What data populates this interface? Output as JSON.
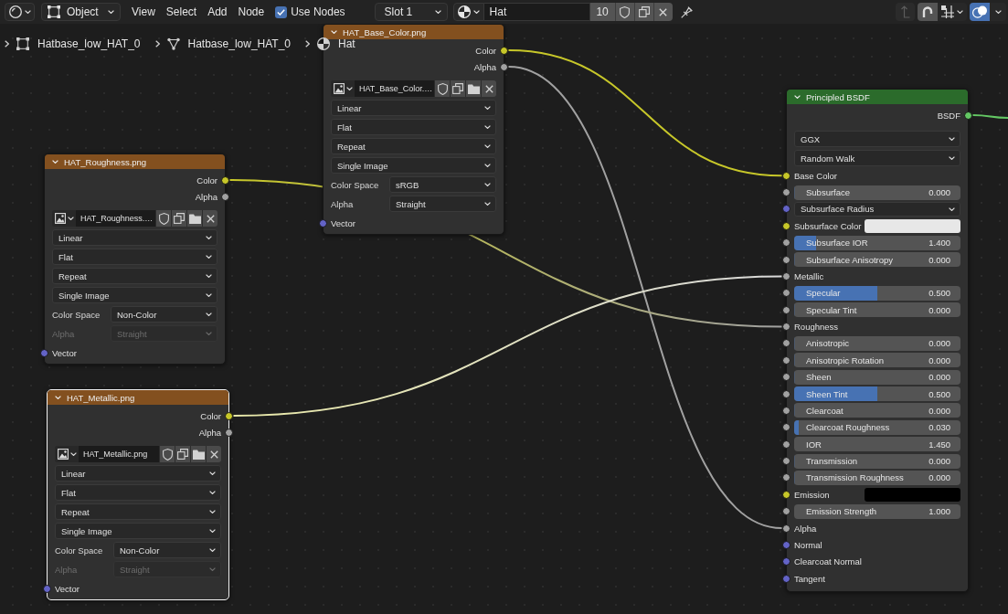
{
  "header": {
    "mode": "Object",
    "menus": [
      "View",
      "Select",
      "Add",
      "Node"
    ],
    "use_nodes": {
      "label": "Use Nodes",
      "checked": true
    },
    "slot": "Slot 1",
    "material": {
      "name": "Hat",
      "users": "10"
    },
    "parent_button": {
      "disabled": true
    },
    "snap": {
      "on": false
    },
    "overlays": {
      "on": true
    }
  },
  "breadcrumbs": [
    {
      "kind": "object",
      "label": "Hatbase_low_HAT_0"
    },
    {
      "kind": "mesh",
      "label": "Hatbase_low_HAT_0"
    },
    {
      "kind": "material",
      "label": "Hat"
    }
  ],
  "nodes": [
    {
      "kind": "image_texture",
      "title": "HAT_Base_Color.png",
      "selected": false,
      "outputs": [
        {
          "label": "Color",
          "socket": {
            "kind": "color"
          },
          "linked": true
        },
        {
          "label": "Alpha",
          "socket": {
            "kind": "float"
          },
          "linked": true
        }
      ],
      "image": "HAT_Base_Color.…",
      "interpolation": "Linear",
      "projection": "Flat",
      "extension": "Repeat",
      "source": "Single Image",
      "color_space": {
        "label": "Color Space",
        "value": "sRGB"
      },
      "alpha": {
        "label": "Alpha",
        "value": "Straight",
        "disabled": false
      },
      "inputs": [
        {
          "label": "Vector",
          "socket": {
            "kind": "vector"
          },
          "kind": "label"
        }
      ]
    },
    {
      "kind": "image_texture",
      "title": "HAT_Roughness.png",
      "selected": false,
      "outputs": [
        {
          "label": "Color",
          "socket": {
            "kind": "color"
          },
          "linked": true
        },
        {
          "label": "Alpha",
          "socket": {
            "kind": "float"
          },
          "linked": false
        }
      ],
      "image": "HAT_Roughness.…",
      "interpolation": "Linear",
      "projection": "Flat",
      "extension": "Repeat",
      "source": "Single Image",
      "color_space": {
        "label": "Color Space",
        "value": "Non-Color"
      },
      "alpha": {
        "label": "Alpha",
        "value": "Straight",
        "disabled": true
      },
      "inputs": [
        {
          "label": "Vector",
          "socket": {
            "kind": "vector"
          },
          "kind": "label"
        }
      ]
    },
    {
      "kind": "image_texture",
      "title": "HAT_Metallic.png",
      "selected": true,
      "outputs": [
        {
          "label": "Color",
          "socket": {
            "kind": "color"
          },
          "linked": true
        },
        {
          "label": "Alpha",
          "socket": {
            "kind": "float"
          },
          "linked": false
        }
      ],
      "image": "HAT_Metallic.png",
      "interpolation": "Linear",
      "projection": "Flat",
      "extension": "Repeat",
      "source": "Single Image",
      "color_space": {
        "label": "Color Space",
        "value": "Non-Color"
      },
      "alpha": {
        "label": "Alpha",
        "value": "Straight",
        "disabled": true
      },
      "inputs": [
        {
          "label": "Vector",
          "socket": {
            "kind": "vector"
          },
          "kind": "label"
        }
      ]
    },
    {
      "kind": "principled_bsdf",
      "title": "Principled BSDF",
      "selected": false,
      "outputs": [
        {
          "label": "BSDF",
          "socket": {
            "kind": "shader"
          },
          "linked": true
        }
      ],
      "distribution": "GGX",
      "subsurface_method": "Random Walk",
      "inputs": [
        {
          "label": "Base Color",
          "socket": {
            "kind": "color"
          },
          "kind": "label"
        },
        {
          "label": "Subsurface",
          "socket": {
            "kind": "float"
          },
          "kind": "slider",
          "value": "0.000",
          "level": 0
        },
        {
          "label": "Subsurface Radius",
          "socket": {
            "kind": "vector"
          },
          "kind": "dropdown"
        },
        {
          "label": "Subsurface Color",
          "socket": {
            "kind": "color"
          },
          "kind": "color",
          "color": "#e7e7e7"
        },
        {
          "label": "Subsurface IOR",
          "socket": {
            "kind": "float"
          },
          "kind": "slider",
          "value": "1.400",
          "level": 0.13
        },
        {
          "label": "Subsurface Anisotropy",
          "socket": {
            "kind": "float"
          },
          "kind": "slider",
          "value": "0.000",
          "level": 0
        },
        {
          "label": "Metallic",
          "socket": {
            "kind": "float"
          },
          "kind": "label"
        },
        {
          "label": "Specular",
          "socket": {
            "kind": "float"
          },
          "kind": "slider",
          "value": "0.500",
          "level": 0.5
        },
        {
          "label": "Specular Tint",
          "socket": {
            "kind": "float"
          },
          "kind": "slider",
          "value": "0.000",
          "level": 0
        },
        {
          "label": "Roughness",
          "socket": {
            "kind": "float"
          },
          "kind": "label"
        },
        {
          "label": "Anisotropic",
          "socket": {
            "kind": "float"
          },
          "kind": "slider",
          "value": "0.000",
          "level": 0
        },
        {
          "label": "Anisotropic Rotation",
          "socket": {
            "kind": "float"
          },
          "kind": "slider",
          "value": "0.000",
          "level": 0
        },
        {
          "label": "Sheen",
          "socket": {
            "kind": "float"
          },
          "kind": "slider",
          "value": "0.000",
          "level": 0
        },
        {
          "label": "Sheen Tint",
          "socket": {
            "kind": "float"
          },
          "kind": "slider",
          "value": "0.500",
          "level": 0.5
        },
        {
          "label": "Clearcoat",
          "socket": {
            "kind": "float"
          },
          "kind": "slider",
          "value": "0.000",
          "level": 0
        },
        {
          "label": "Clearcoat Roughness",
          "socket": {
            "kind": "float"
          },
          "kind": "slider",
          "value": "0.030",
          "level": 0.03
        },
        {
          "label": "IOR",
          "socket": {
            "kind": "float"
          },
          "kind": "number",
          "value": "1.450"
        },
        {
          "label": "Transmission",
          "socket": {
            "kind": "float"
          },
          "kind": "slider",
          "value": "0.000",
          "level": 0
        },
        {
          "label": "Transmission Roughness",
          "socket": {
            "kind": "float"
          },
          "kind": "slider",
          "value": "0.000",
          "level": 0
        },
        {
          "label": "Emission",
          "socket": {
            "kind": "color"
          },
          "kind": "color",
          "color": "#000000"
        },
        {
          "label": "Emission Strength",
          "socket": {
            "kind": "float"
          },
          "kind": "number",
          "value": "1.000"
        },
        {
          "label": "Alpha",
          "socket": {
            "kind": "float"
          },
          "kind": "label"
        },
        {
          "label": "Normal",
          "socket": {
            "kind": "vector"
          },
          "kind": "label"
        },
        {
          "label": "Clearcoat Normal",
          "socket": {
            "kind": "vector"
          },
          "kind": "label"
        },
        {
          "label": "Tangent",
          "socket": {
            "kind": "vector"
          },
          "kind": "label"
        }
      ]
    }
  ]
}
